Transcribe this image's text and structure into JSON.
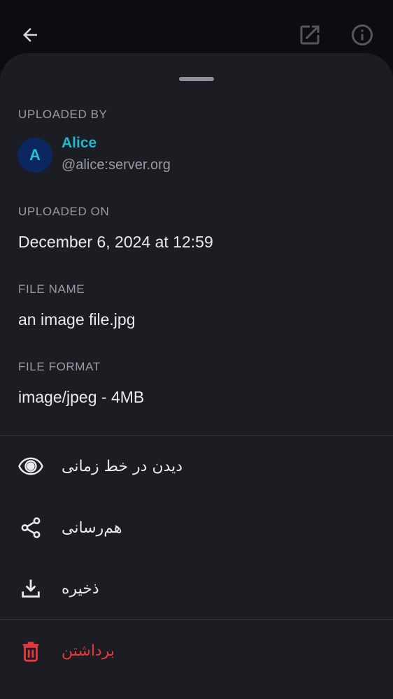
{
  "colors": {
    "accent": "#22b8cc",
    "danger": "#e8383f",
    "avatar_bg": "#0c2660",
    "sheet_bg": "#1b1d22"
  },
  "topbar": {
    "back_icon": "arrow-left-icon",
    "open_icon": "open-external-icon",
    "info_icon": "info-icon"
  },
  "uploaded_by": {
    "label": "UPLOADED BY",
    "avatar_initial": "A",
    "name": "Alice",
    "user_id": "@alice:server.org"
  },
  "uploaded_on": {
    "label": "UPLOADED ON",
    "value": "December 6, 2024 at 12:59"
  },
  "file_name": {
    "label": "FILE NAME",
    "value": "an image file.jpg"
  },
  "file_format": {
    "label": "FILE FORMAT",
    "value": "image/jpeg - 4MB"
  },
  "actions": [
    {
      "label": "دیدن در خط زمانی",
      "icon": "eye-icon"
    },
    {
      "label": "هم‌رسانی",
      "icon": "share-icon"
    },
    {
      "label": "ذخیره",
      "icon": "download-icon"
    },
    {
      "label": "برداشتن",
      "icon": "delete-icon"
    }
  ]
}
